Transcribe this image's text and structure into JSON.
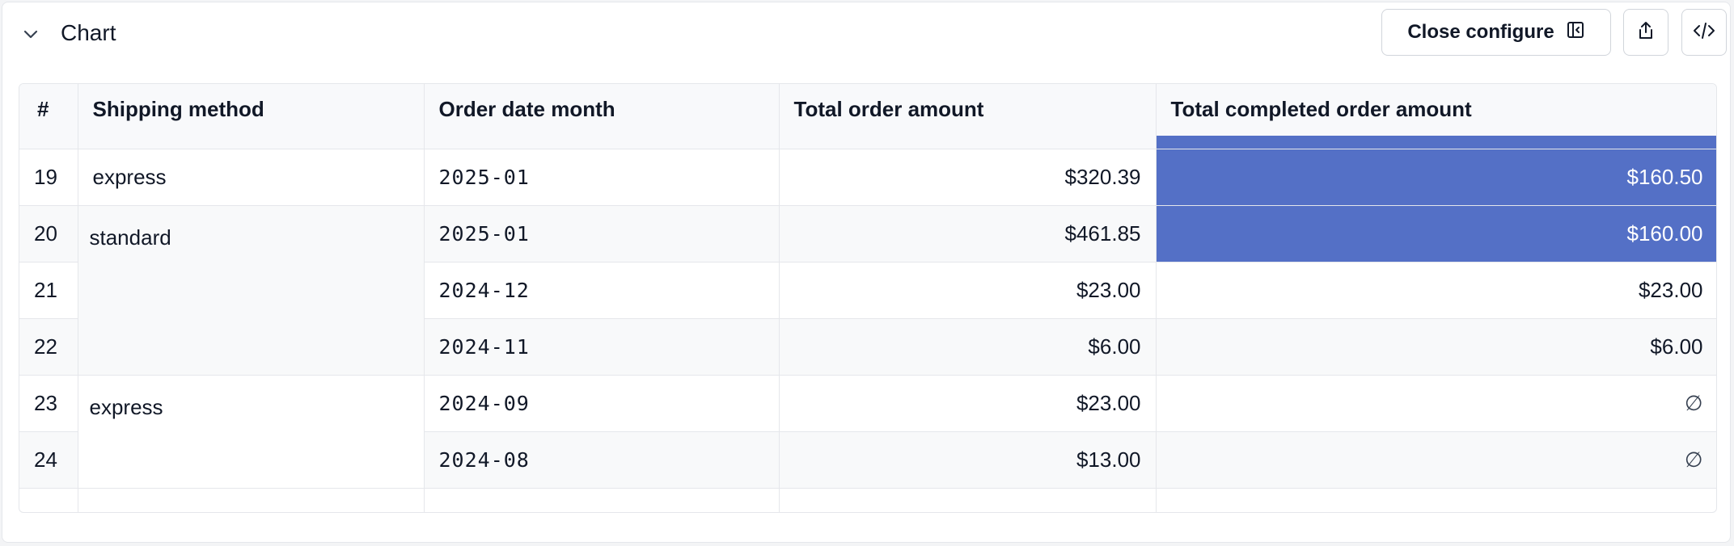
{
  "header": {
    "title": "Chart",
    "configure_label": "Close configure"
  },
  "icons": {
    "collapse": "chevron-down-icon",
    "panel": "panel-left-icon",
    "share": "share-icon",
    "code": "code-icon"
  },
  "colors": {
    "highlight": "#5470c6",
    "border": "#e5e7eb"
  },
  "table": {
    "columns": [
      "#",
      "Shipping method",
      "Order date month",
      "Total order amount",
      "Total completed order amount"
    ],
    "rows": [
      {
        "num": "19",
        "shipping": "express",
        "month": "2025-01",
        "total": "$320.39",
        "completed": "$160.50",
        "highlight": true
      },
      {
        "num": "20",
        "shipping": "standard",
        "month": "2025-01",
        "total": "$461.85",
        "completed": "$160.00",
        "highlight": true
      },
      {
        "num": "21",
        "shipping": "",
        "month": "2024-12",
        "total": "$23.00",
        "completed": "$23.00",
        "highlight": false
      },
      {
        "num": "22",
        "shipping": "",
        "month": "2024-11",
        "total": "$6.00",
        "completed": "$6.00",
        "highlight": false
      },
      {
        "num": "23",
        "shipping": "express",
        "month": "2024-09",
        "total": "$23.00",
        "completed": "∅",
        "highlight": false
      },
      {
        "num": "24",
        "shipping": "",
        "month": "2024-08",
        "total": "$13.00",
        "completed": "∅",
        "highlight": false
      }
    ]
  }
}
